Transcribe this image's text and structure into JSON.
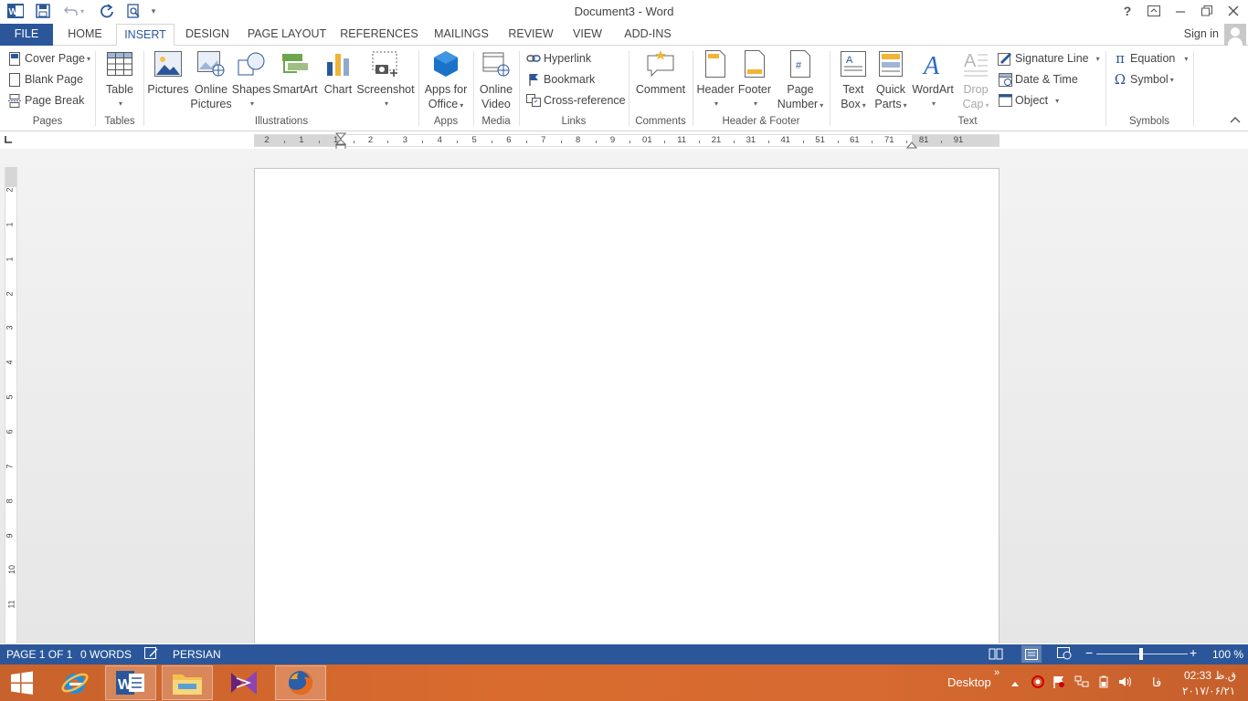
{
  "window": {
    "title": "Document3 - Word",
    "help": "?"
  },
  "tabs": [
    "FILE",
    "HOME",
    "INSERT",
    "DESIGN",
    "PAGE LAYOUT",
    "REFERENCES",
    "MAILINGS",
    "REVIEW",
    "VIEW",
    "ADD-INS"
  ],
  "active_tab": "INSERT",
  "signin": "Sign in",
  "ribbon": {
    "pages": {
      "label": "Pages",
      "cover_page": "Cover Page",
      "blank_page": "Blank Page",
      "page_break": "Page Break"
    },
    "tables": {
      "label": "Tables",
      "table": "Table"
    },
    "illustrations": {
      "label": "Illustrations",
      "pictures": "Pictures",
      "online_pictures_1": "Online",
      "online_pictures_2": "Pictures",
      "shapes": "Shapes",
      "smartart": "SmartArt",
      "chart": "Chart",
      "screenshot": "Screenshot"
    },
    "apps": {
      "label": "Apps",
      "line1": "Apps for",
      "line2": "Office"
    },
    "media": {
      "label": "Media",
      "line1": "Online",
      "line2": "Video"
    },
    "links": {
      "label": "Links",
      "hyperlink": "Hyperlink",
      "bookmark": "Bookmark",
      "cross_reference": "Cross-reference"
    },
    "comments": {
      "label": "Comments",
      "comment": "Comment"
    },
    "header_footer": {
      "label": "Header & Footer",
      "header": "Header",
      "footer": "Footer",
      "page_number_1": "Page",
      "page_number_2": "Number"
    },
    "text": {
      "label": "Text",
      "text_box_1": "Text",
      "text_box_2": "Box",
      "quick_parts_1": "Quick",
      "quick_parts_2": "Parts",
      "wordart": "WordArt",
      "drop_cap_1": "Drop",
      "drop_cap_2": "Cap",
      "signature_line": "Signature Line",
      "date_time": "Date & Time",
      "object": "Object"
    },
    "symbols": {
      "label": "Symbols",
      "equation": "Equation",
      "symbol": "Symbol"
    }
  },
  "ruler": {
    "labels": [
      "2",
      "1",
      "1",
      "2",
      "3",
      "4",
      "5",
      "6",
      "7",
      "8",
      "9",
      "01",
      "11",
      "21",
      "31",
      "41",
      "51",
      "61",
      "71",
      "81",
      "91"
    ],
    "vertical_labels": [
      "2",
      "1",
      "1",
      "2",
      "3",
      "4",
      "5",
      "6",
      "7",
      "8",
      "9",
      "10",
      "11"
    ]
  },
  "status": {
    "page": "PAGE 1 OF 1",
    "words": "0 WORDS",
    "language": "PERSIAN",
    "zoom": "100 %"
  },
  "taskbar": {
    "desktop": "Desktop",
    "lang": "فا",
    "time": "02:33 ق.ظ",
    "date": "٢٠١٧/٠۶/٢١"
  },
  "colors": {
    "accent": "#2b579a",
    "taskbar": "#d66a30"
  }
}
